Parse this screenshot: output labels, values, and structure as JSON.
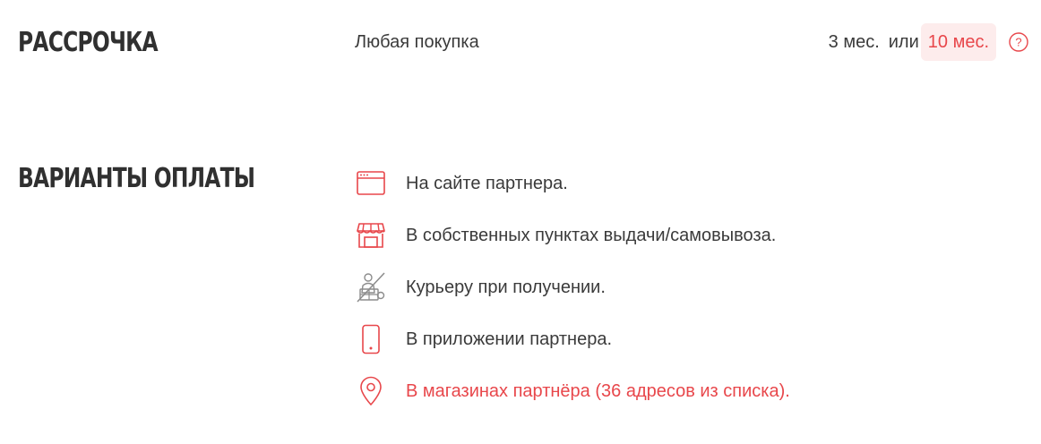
{
  "installment": {
    "title": "Рассрочка",
    "description": "Любая покупка",
    "terms": [
      {
        "label": "3 мес.",
        "active": false
      },
      {
        "label": "10 мес.",
        "active": true
      }
    ],
    "or_label": "или",
    "help_icon": "question-circle-icon"
  },
  "payment": {
    "title": "Варианты оплаты",
    "options": [
      {
        "icon": "browser-window-icon",
        "label": "На сайте партнера."
      },
      {
        "icon": "storefront-icon",
        "label": "В собственных пунктах выдачи/самовывоза."
      },
      {
        "icon": "courier-icon",
        "label": "Курьеру при получении."
      },
      {
        "icon": "smartphone-icon",
        "label": "В приложении партнера."
      },
      {
        "icon": "map-pin-icon",
        "label": "В магазинах партнёра (36 адресов из списка)."
      }
    ]
  },
  "colors": {
    "accent": "#e8474b",
    "accent_bg": "#fdecec",
    "text": "#3a3a3a",
    "title": "#303030",
    "disabled_icon": "#8c8c8c"
  }
}
